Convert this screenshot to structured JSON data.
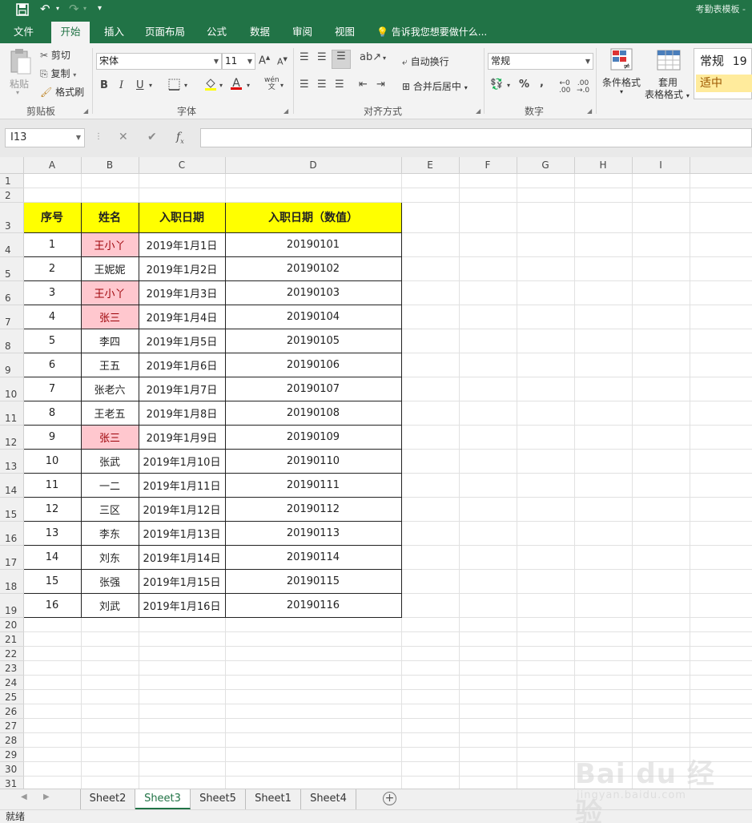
{
  "titlebar": {
    "doc_title": "考勤表模板 -"
  },
  "ribbon_tabs": [
    "文件",
    "开始",
    "插入",
    "页面布局",
    "公式",
    "数据",
    "审阅",
    "视图"
  ],
  "tell_me": "告诉我您想要做什么...",
  "clipboard": {
    "paste": "粘贴",
    "cut": "剪切",
    "copy": "复制",
    "format_painter": "格式刷",
    "group_label": "剪贴板"
  },
  "font": {
    "name": "宋体",
    "size": "11",
    "bold": "B",
    "italic": "I",
    "underline": "U",
    "group_label": "字体"
  },
  "alignment": {
    "wrap_text": "自动换行",
    "merge_center": "合并后居中",
    "group_label": "对齐方式"
  },
  "number": {
    "format": "常规",
    "group_label": "数字"
  },
  "styles": {
    "conditional_format": "条件格式",
    "format_as_table_1": "套用",
    "format_as_table_2": "表格格式",
    "normal_style": "常规",
    "normal_value": "19",
    "neutral_style": "适中"
  },
  "formula_bar": {
    "name_box": "I13",
    "formula": ""
  },
  "columns": [
    "A",
    "B",
    "C",
    "D",
    "E",
    "F",
    "G",
    "H",
    "I"
  ],
  "table_header": [
    "序号",
    "姓名",
    "入职日期",
    "入职日期（数值）"
  ],
  "table_rows": [
    {
      "no": "1",
      "name": "王小丫",
      "date": "2019年1月1日",
      "num": "20190101",
      "dup": true
    },
    {
      "no": "2",
      "name": "王妮妮",
      "date": "2019年1月2日",
      "num": "20190102",
      "dup": false
    },
    {
      "no": "3",
      "name": "王小丫",
      "date": "2019年1月3日",
      "num": "20190103",
      "dup": true
    },
    {
      "no": "4",
      "name": "张三",
      "date": "2019年1月4日",
      "num": "20190104",
      "dup": true
    },
    {
      "no": "5",
      "name": "李四",
      "date": "2019年1月5日",
      "num": "20190105",
      "dup": false
    },
    {
      "no": "6",
      "name": "王五",
      "date": "2019年1月6日",
      "num": "20190106",
      "dup": false
    },
    {
      "no": "7",
      "name": "张老六",
      "date": "2019年1月7日",
      "num": "20190107",
      "dup": false
    },
    {
      "no": "8",
      "name": "王老五",
      "date": "2019年1月8日",
      "num": "20190108",
      "dup": false
    },
    {
      "no": "9",
      "name": "张三",
      "date": "2019年1月9日",
      "num": "20190109",
      "dup": true
    },
    {
      "no": "10",
      "name": "张武",
      "date": "2019年1月10日",
      "num": "20190110",
      "dup": false
    },
    {
      "no": "11",
      "name": "一二",
      "date": "2019年1月11日",
      "num": "20190111",
      "dup": false
    },
    {
      "no": "12",
      "name": "三区",
      "date": "2019年1月12日",
      "num": "20190112",
      "dup": false
    },
    {
      "no": "13",
      "name": "李东",
      "date": "2019年1月13日",
      "num": "20190113",
      "dup": false
    },
    {
      "no": "14",
      "name": "刘东",
      "date": "2019年1月14日",
      "num": "20190114",
      "dup": false
    },
    {
      "no": "15",
      "name": "张强",
      "date": "2019年1月15日",
      "num": "20190115",
      "dup": false
    },
    {
      "no": "16",
      "name": "刘武",
      "date": "2019年1月16日",
      "num": "20190116",
      "dup": false
    }
  ],
  "sheet_tabs": [
    {
      "label": "Sheet2",
      "active": false
    },
    {
      "label": "Sheet3",
      "active": true
    },
    {
      "label": "Sheet5",
      "active": false
    },
    {
      "label": "Sheet1",
      "active": false
    },
    {
      "label": "Sheet4",
      "active": false
    }
  ],
  "status": "就绪",
  "watermark": {
    "main": "Bai du 经验",
    "sub": "jingyan.baidu.com"
  },
  "colors": {
    "excel_green": "#217346",
    "header_fill": "#ffff00",
    "duplicate_fill": "#ffc7ce",
    "duplicate_text": "#9c0006"
  }
}
